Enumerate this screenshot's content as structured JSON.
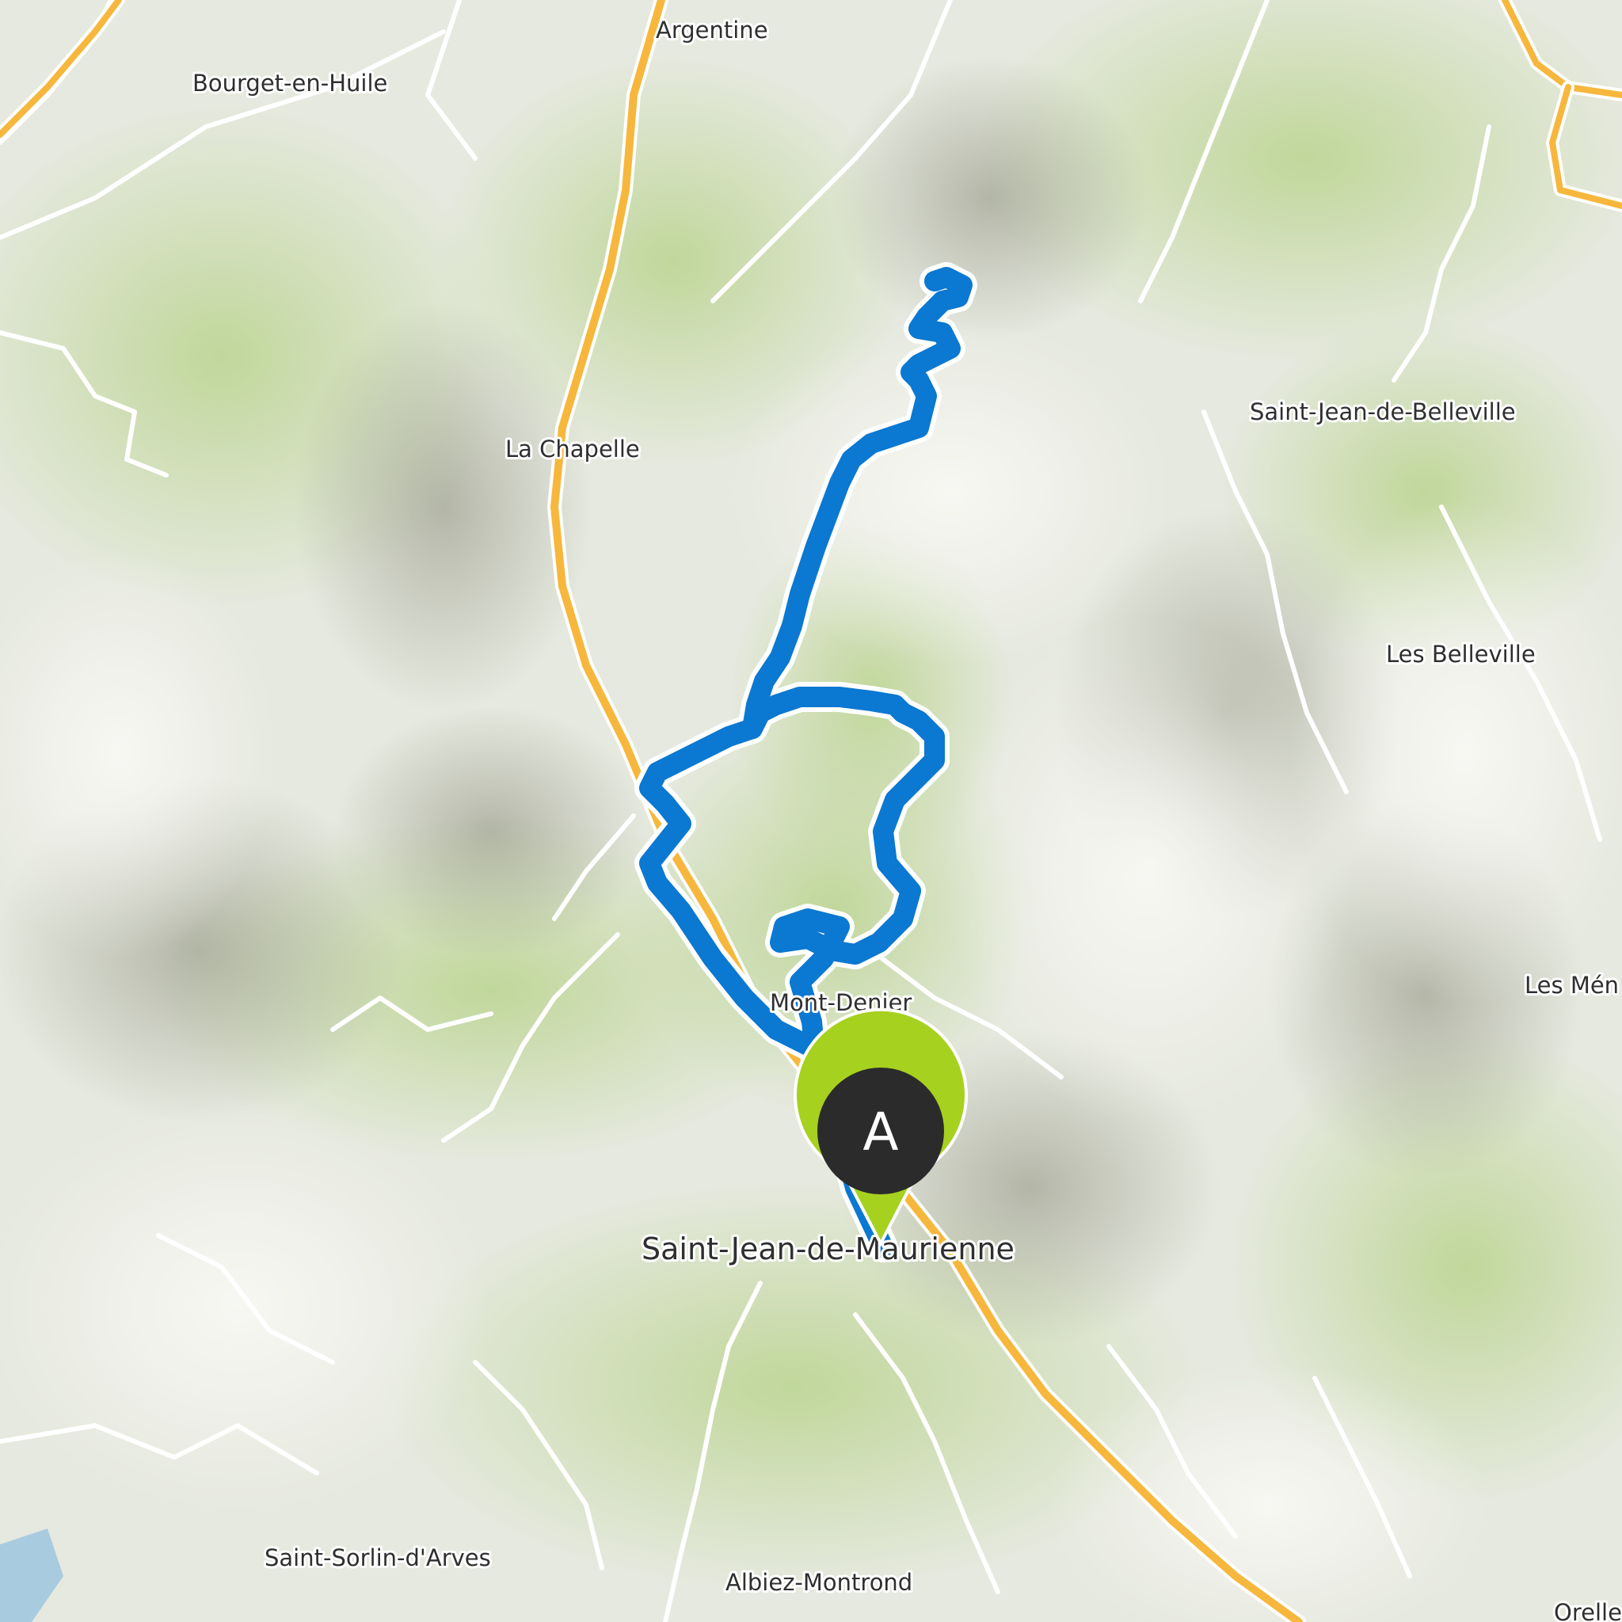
{
  "map": {
    "type": "terrain-map",
    "route": {
      "color": "#0b78d1",
      "shape": "loop with northern spur",
      "start_marker": "A"
    },
    "marker": {
      "label": "A",
      "fill": "#2b2b2b",
      "ring_color": "#a6d11f",
      "icon": "map-pin-icon"
    },
    "road_colors": {
      "motorway": "#f6b73c",
      "minor_road": "#ffffff"
    },
    "places": {
      "argentine": "Argentine",
      "bourget": "Bourget-en-Huile",
      "chapelle": "La Chapelle",
      "sjbelleville": "Saint-Jean-de-Belleville",
      "belleville": "Les Belleville",
      "menuires": "Les Mén",
      "montdenis": "Mont-Denier",
      "sjm": "Saint-Jean-de-Maurienne",
      "sorlin": "Saint-Sorlin-d'Arves",
      "albiez": "Albiez-Montrond",
      "orelle": "Orelle"
    }
  }
}
